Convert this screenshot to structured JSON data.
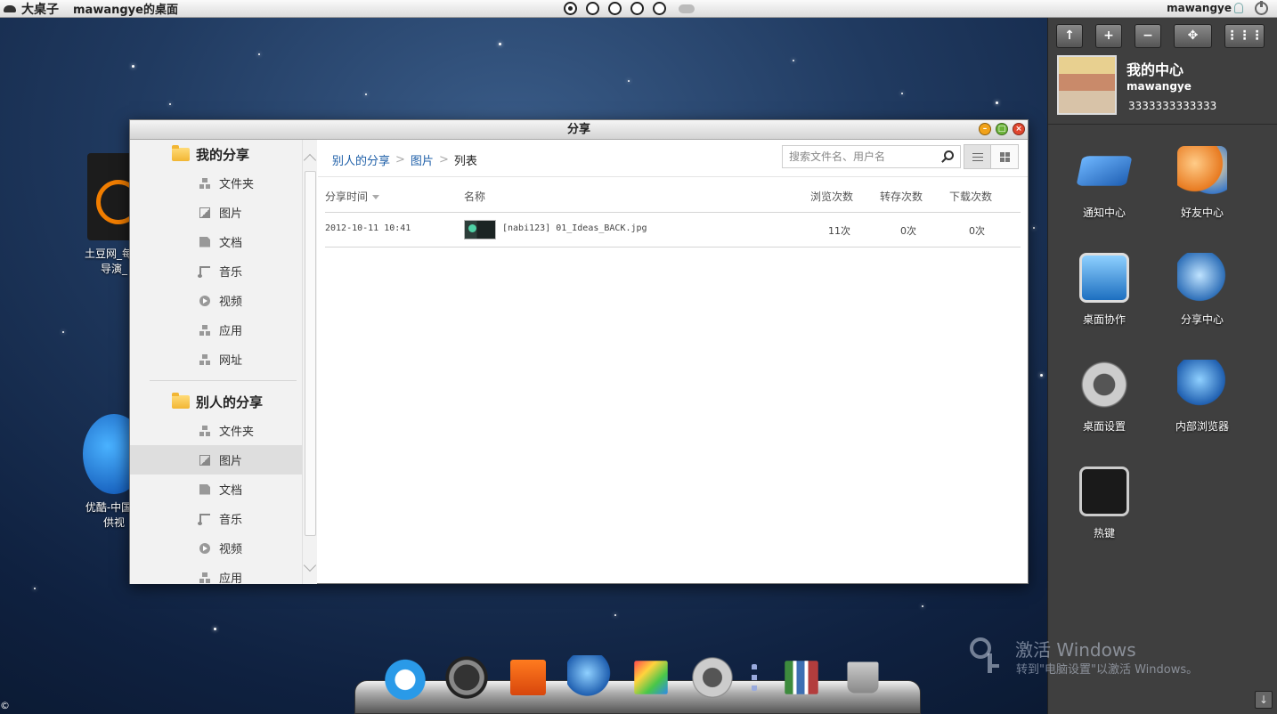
{
  "topbar": {
    "brand": "大桌子",
    "desktop_title": "mawangye的桌面",
    "desktop_dots": 5,
    "active_dot_index": 0,
    "username": "mawangye"
  },
  "desktop_icons": {
    "tudou_label_1": "土豆网_每个",
    "tudou_label_2": "导演_",
    "youku_label_1": "优酷-中国第",
    "youku_label_2": "供视"
  },
  "window": {
    "title": "分享",
    "sidebar": {
      "my_share": {
        "title": "我的分享",
        "items": [
          "文件夹",
          "图片",
          "文档",
          "音乐",
          "视频",
          "应用",
          "网址"
        ]
      },
      "others_share": {
        "title": "别人的分享",
        "items": [
          "文件夹",
          "图片",
          "文档",
          "音乐",
          "视频",
          "应用"
        ],
        "selected": "图片"
      }
    },
    "breadcrumb": [
      "别人的分享",
      "图片",
      "列表"
    ],
    "search_placeholder": "搜索文件名、用户名",
    "columns": {
      "time": "分享时间",
      "name": "名称",
      "views": "浏览次数",
      "saves": "转存次数",
      "downloads": "下载次数"
    },
    "rows": [
      {
        "time": "2012-10-11 10:41",
        "name": "[nabi123] 01_Ideas_BACK.jpg",
        "views": "11次",
        "saves": "0次",
        "downloads": "0次"
      }
    ]
  },
  "right_panel": {
    "profile": {
      "title": "我的中心",
      "username": "mawangye",
      "number": "3333333333333"
    },
    "apps": [
      "通知中心",
      "好友中心",
      "桌面协作",
      "分享中心",
      "桌面设置",
      "内部浏览器",
      "热键"
    ]
  },
  "watermark": {
    "line1": "激活 Windows",
    "line2": "转到\"电脑设置\"以激活 Windows。"
  },
  "copyright": "©"
}
